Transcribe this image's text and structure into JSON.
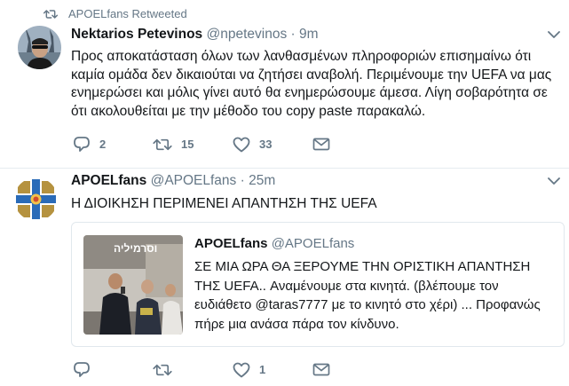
{
  "colors": {
    "accent": "#1da1f2",
    "muted": "#657786",
    "text": "#14171a",
    "border": "#e1e8ed"
  },
  "tweets": [
    {
      "retweet_label": "APOELfans Retweeted",
      "name": "Nektarios Petevinos",
      "handle": "@npetevinos",
      "separator": "·",
      "time": "9m",
      "text": "Προς αποκατάσταση όλων των λανθασμένων πληροφοριών επισημαίνω ότι καμία ομάδα δεν δικαιούται να ζητήσει αναβολή. Περιμένουμε την UEFA να μας ενημερώσει και μόλις γίνει αυτό θα ενημερώσουμε άμεσα. Λίγη σοβαρότητα σε ότι ακολουθείται με την μέθοδο του copy paste παρακαλώ.",
      "replies": "2",
      "retweets": "15",
      "likes": "33",
      "icons": [
        "reply-icon",
        "retweet-icon",
        "heart-icon",
        "mail-icon"
      ]
    },
    {
      "name": "APOELfans",
      "handle": "@APOELfans",
      "separator": "·",
      "time": "25m",
      "text": "Η ΔΙΟΙΚΗΣΗ ΠΕΡΙΜΕΝΕΙ ΑΠΑΝΤΗΣΗ ΤΗΣ UEFA",
      "replies": "",
      "retweets": "",
      "likes": "1",
      "quote": {
        "name": "APOELfans",
        "handle": "@APOELfans",
        "image_caption": "וסרמיליה",
        "text": "ΣΕ ΜΙΑ ΩΡΑ ΘΑ ΞΕΡΟΥΜΕ ΤΗΝ ΟΡΙΣΤΙΚΗ ΑΠΑΝΤΗΣΗ ΤΗΣ UEFA.. Αναμένουμε στα κινητά. (βλέπουμε τον ευδιάθετο @taras7777 με το κινητό στο χέρι) ... Προφανώς πήρε μια ανάσα πάρα τον κίνδυνο."
      }
    }
  ]
}
